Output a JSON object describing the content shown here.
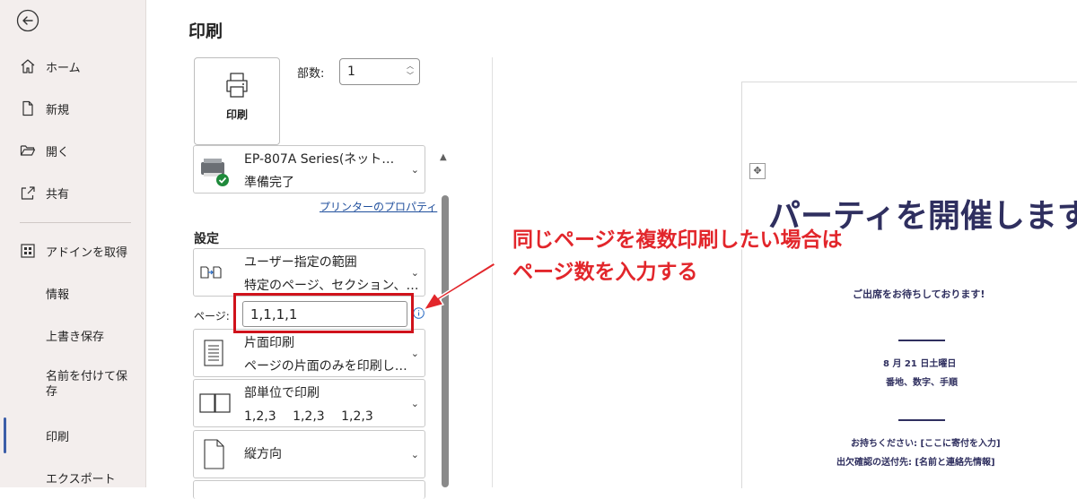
{
  "sidebar": {
    "items": [
      {
        "label": "ホーム",
        "icon": "home-icon"
      },
      {
        "label": "新規",
        "icon": "new-document-icon"
      },
      {
        "label": "開く",
        "icon": "folder-open-icon"
      },
      {
        "label": "共有",
        "icon": "share-icon"
      },
      {
        "label": "アドインを取得",
        "icon": "addins-grid-icon"
      },
      {
        "label": "情報"
      },
      {
        "label": "上書き保存"
      },
      {
        "label": "名前を付けて保存"
      },
      {
        "label": "印刷"
      },
      {
        "label": "エクスポート"
      }
    ],
    "active_item": "印刷"
  },
  "print": {
    "title": "印刷",
    "print_button_label": "印刷",
    "copies_label": "部数:",
    "copies_value": "1",
    "printer": {
      "name": "EP-807A Series(ネット…",
      "status": "準備完了",
      "properties_link": "プリンターのプロパティ"
    },
    "settings_heading": "設定",
    "range": {
      "title": "ユーザー指定の範囲",
      "subtitle": "特定のページ、セクション、…"
    },
    "pages_label": "ページ:",
    "pages_value": "1,1,1,1",
    "sides": {
      "title": "片面印刷",
      "subtitle": "ページの片面のみを印刷し…"
    },
    "collate": {
      "title": "部単位で印刷",
      "subtitle": "1,2,3　 1,2,3　 1,2,3"
    },
    "orientation": {
      "title": "縦方向"
    }
  },
  "preview": {
    "title": "パーティを開催します",
    "tagline": "ご出席をお待ちしております!",
    "date": "8 月 21 日土曜日",
    "address": "番地、数字、手順",
    "bring": "お持ちください: [ここに寄付を入力]",
    "rsvp": "出欠確認の送付先: [名前と連絡先情報]",
    "title_color": "#2f2f5f"
  },
  "annotation": {
    "line1": "同じページを複数印刷したい場合は",
    "line2": "ページ数を入力する",
    "color": "#e2262b"
  }
}
